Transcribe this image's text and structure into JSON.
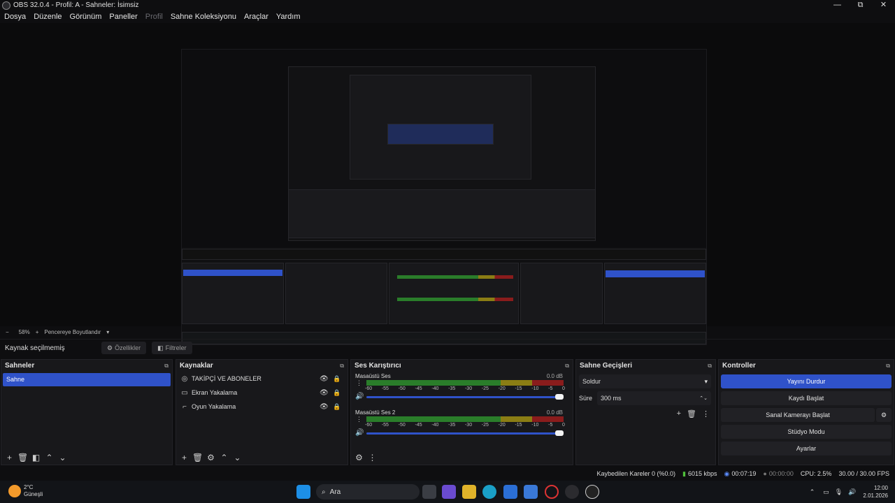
{
  "window": {
    "title": "OBS 32.0.4 - Profil: A - Sahneler: İsimsiz",
    "min": "—",
    "max": "⧉",
    "close": "✕"
  },
  "menu": [
    "Dosya",
    "Düzenle",
    "Görünüm",
    "Paneller",
    "Profil",
    "Sahne Koleksiyonu",
    "Araçlar",
    "Yardım"
  ],
  "zoom": {
    "minus": "−",
    "value": "58%",
    "plus": "+",
    "mode": "Pencereye Boyutlandır",
    "arrow": "▾"
  },
  "source_bar": {
    "label": "Kaynak seçilmemiş",
    "props": "Özellikler",
    "filters": "Filtreler"
  },
  "scenes": {
    "title": "Sahneler",
    "items": [
      "Sahne"
    ]
  },
  "sources": {
    "title": "Kaynaklar",
    "items": [
      {
        "name": "TAKİPÇİ VE ABONELER",
        "icon": "browser-icon"
      },
      {
        "name": "Ekran Yakalama",
        "icon": "monitor-icon"
      },
      {
        "name": "Oyun Yakalama",
        "icon": "gamepad-icon"
      }
    ]
  },
  "mixer": {
    "title": "Ses Karıştırıcı",
    "channels": [
      {
        "name": "Masaüstü Ses",
        "db": "0.0 dB",
        "level": 0.86
      },
      {
        "name": "Masaüstü Ses 2",
        "db": "0.0 dB",
        "level": 0.86
      }
    ],
    "scale": [
      "-60",
      "-55",
      "-50",
      "-45",
      "-40",
      "-35",
      "-30",
      "-25",
      "-20",
      "-15",
      "-10",
      "-5",
      "0"
    ]
  },
  "transitions": {
    "title": "Sahne Geçişleri",
    "selected": "Soldur",
    "duration_label": "Süre",
    "duration": "300 ms"
  },
  "controls": {
    "title": "Kontroller",
    "buttons": [
      "Yayını Durdur",
      "Kaydı Başlat",
      "Sanal Kamerayı Başlat",
      "Stüdyo Modu",
      "Ayarlar"
    ]
  },
  "status": {
    "dropped": "Kaybedilen Kareler 0 (%0.0)",
    "bitrate": "6015 kbps",
    "stream_time": "00:07:19",
    "rec_time": "00:00:00",
    "cpu": "CPU: 2.5%",
    "fps": "30.00 / 30.00 FPS"
  },
  "taskbar": {
    "weather_temp": "2°C",
    "weather_label": "Güneşli",
    "search": "Ara",
    "time": "12:00",
    "date": "2.01.2026"
  }
}
